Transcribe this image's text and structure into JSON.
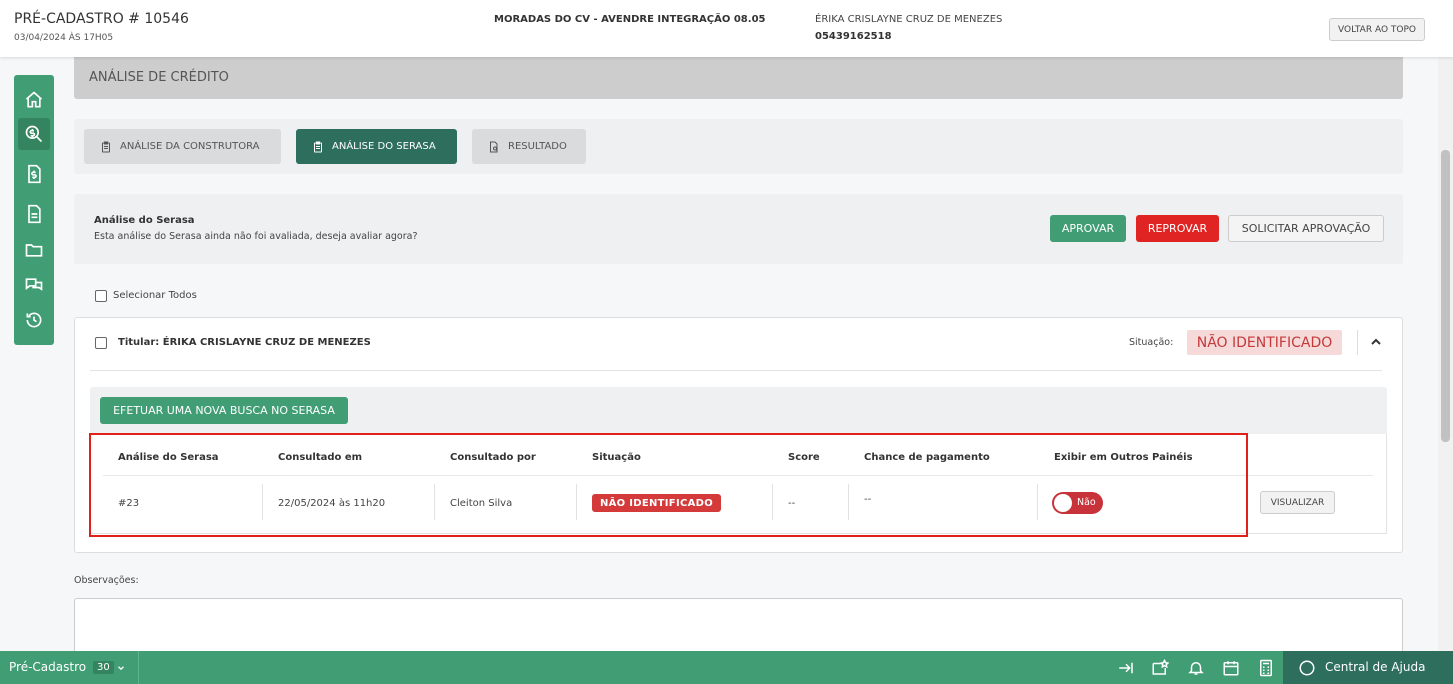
{
  "header": {
    "title": "PRÉ-CADASTRO # 10546",
    "date": "03/04/2024 ÀS 17H05",
    "enterprise": "MORADAS DO CV - AVENDRE INTEGRAÇÃO 08.05",
    "client_name": "ÉRIKA CRISLAYNE CRUZ DE MENEZES",
    "client_cpf": "05439162518",
    "back_to_top": "VOLTAR AO TOPO"
  },
  "sidebar": {
    "items": [
      {
        "icon": "home-icon"
      },
      {
        "icon": "credit-search-icon",
        "active": true
      },
      {
        "icon": "money-document-icon"
      },
      {
        "icon": "document-icon"
      },
      {
        "icon": "folder-icon"
      },
      {
        "icon": "chat-icon"
      },
      {
        "icon": "history-icon"
      }
    ]
  },
  "section": {
    "title": "ANÁLISE DE CRÉDITO"
  },
  "tabs": [
    {
      "label": "ANÁLISE DA CONSTRUTORA"
    },
    {
      "label": "ANÁLISE DO SERASA",
      "active": true
    },
    {
      "label": "RESULTADO"
    }
  ],
  "analysis": {
    "title": "Análise do Serasa",
    "description": "Esta análise do Serasa ainda não foi avaliada, deseja avaliar agora?",
    "approve": "APROVAR",
    "reject": "REPROVAR",
    "request": "SOLICITAR APROVAÇÃO"
  },
  "select_all": "Selecionar Todos",
  "titular": {
    "label": "Titular: ÉRIKA CRISLAYNE CRUZ DE MENEZES",
    "situation_label": "Situação:",
    "situation_value": "NÃO IDENTIFICADO",
    "new_search": "EFETUAR UMA NOVA BUSCA NO SERASA"
  },
  "table": {
    "headers": [
      "Análise do Serasa",
      "Consultado em",
      "Consultado por",
      "Situação",
      "Score",
      "Chance de pagamento",
      "Exibir em Outros Painéis"
    ],
    "rows": [
      {
        "id": "#23",
        "consulted_at": "22/05/2024 às 11h20",
        "consulted_by": "Cleiton Silva",
        "situation": "NÃO IDENTIFICADO",
        "score": "--",
        "chance": "--",
        "show_other": "Não",
        "view": "VISUALIZAR"
      }
    ]
  },
  "observations": {
    "label": "Observações:"
  },
  "bottombar": {
    "label": "Pré-Cadastro",
    "count": "30",
    "help": "Central de Ajuda"
  },
  "colors": {
    "primary": "#419d74",
    "primary_dark": "#2e6e5d",
    "danger": "#e02424",
    "highlight": "#e0201b"
  }
}
